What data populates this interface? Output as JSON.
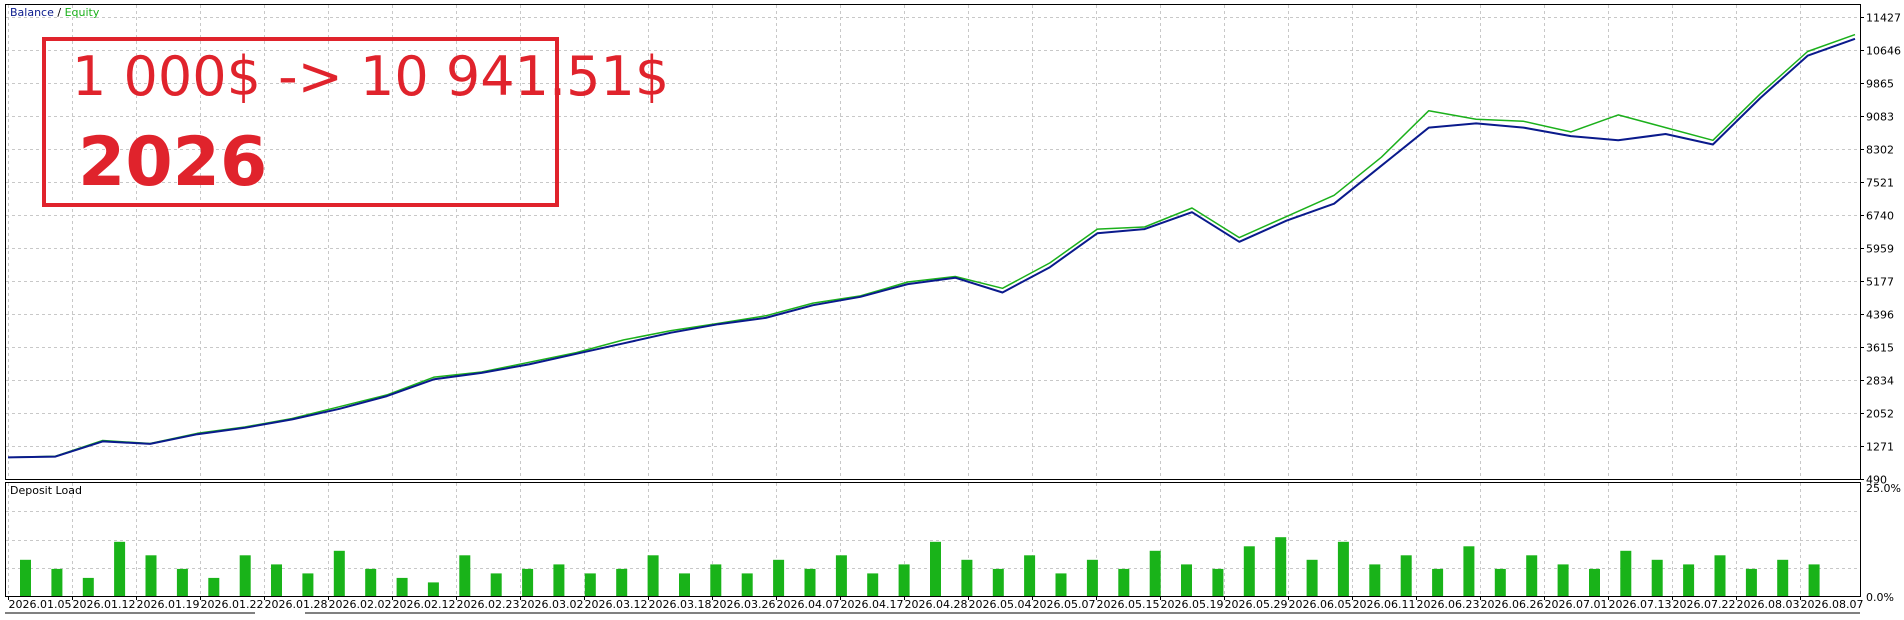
{
  "legend": {
    "balance": "Balance",
    "separator": " / ",
    "equity": "Equity",
    "balance_color": "#0a1a8c",
    "equity_color": "#1bb01b"
  },
  "banner": {
    "line1": "1 000$ -> 10 941.51$",
    "line2": "2026",
    "color": "#e0232c"
  },
  "sub_panel": {
    "title": "Deposit Load",
    "y_top_label": "25.0%",
    "y_bottom_label": "0.0%"
  },
  "chart_data": [
    {
      "type": "line",
      "series": [
        {
          "name": "Balance",
          "color": "#0a1a8c",
          "values": [
            1000,
            1020,
            1380,
            1320,
            1550,
            1700,
            1900,
            2150,
            2450,
            2850,
            3000,
            3200,
            3450,
            3700,
            3950,
            4150,
            4300,
            4600,
            4800,
            5100,
            5250,
            4900,
            5500,
            6300,
            6400,
            6800,
            6100,
            6600,
            7000,
            7900,
            8800,
            8900,
            8800,
            8600,
            8500,
            8650,
            8400,
            9500,
            10500,
            10900
          ]
        },
        {
          "name": "Equity",
          "color": "#1bb01b",
          "values": [
            1000,
            1030,
            1400,
            1330,
            1570,
            1720,
            1920,
            2200,
            2480,
            2900,
            3020,
            3250,
            3480,
            3780,
            4000,
            4170,
            4350,
            4650,
            4820,
            5150,
            5280,
            5000,
            5600,
            6400,
            6450,
            6900,
            6200,
            6700,
            7200,
            8100,
            9200,
            9000,
            8950,
            8700,
            9100,
            8800,
            8500,
            9600,
            10600,
            11000
          ]
        }
      ],
      "y_ticks": [
        "11427",
        "10646",
        "9865",
        "9083",
        "8302",
        "7521",
        "6740",
        "5959",
        "5177",
        "4396",
        "3615",
        "2834",
        "2052",
        "1271",
        "490"
      ],
      "ylim": [
        490,
        11700
      ],
      "x_ticks": [
        "2026.01.05",
        "2026.01.12",
        "2026.01.19",
        "2026.01.22",
        "2026.01.28",
        "2026.02.02",
        "2026.02.12",
        "2026.02.23",
        "2026.03.02",
        "2026.03.12",
        "2026.03.18",
        "2026.03.26",
        "2026.04.07",
        "2026.04.17",
        "2026.04.28",
        "2026.05.04",
        "2026.05.07",
        "2026.05.15",
        "2026.05.19",
        "2026.05.29",
        "2026.06.05",
        "2026.06.11",
        "2026.06.23",
        "2026.06.26",
        "2026.07.01",
        "2026.07.13",
        "2026.07.22",
        "2026.08.03",
        "2026.08.07"
      ],
      "grid": true
    },
    {
      "type": "bar",
      "name": "Deposit Load",
      "ylim": [
        0,
        25
      ],
      "values": [
        8,
        6,
        4,
        12,
        9,
        6,
        4,
        9,
        7,
        5,
        10,
        6,
        4,
        3,
        9,
        5,
        6,
        7,
        5,
        6,
        9,
        5,
        7,
        5,
        8,
        6,
        9,
        5,
        7,
        12,
        8,
        6,
        9,
        5,
        8,
        6,
        10,
        7,
        6,
        11,
        13,
        8,
        12,
        7,
        9,
        6,
        11,
        6,
        9,
        7,
        6,
        10,
        8,
        7,
        9,
        6,
        8,
        7
      ]
    }
  ]
}
